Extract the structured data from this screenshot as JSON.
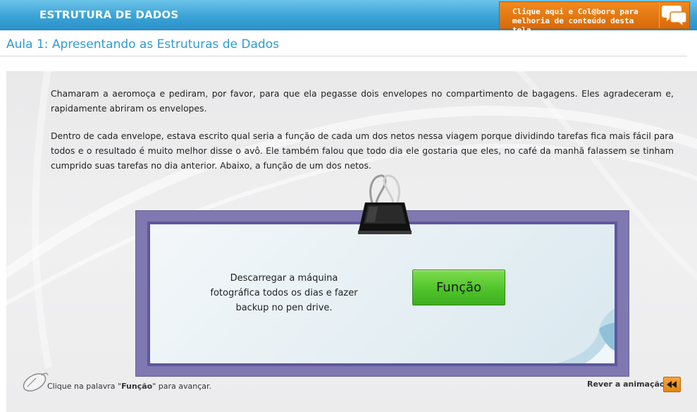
{
  "header": {
    "title": "ESTRUTURA DE DADOS",
    "collab_line1": "Clique aqui e Col@bore para",
    "collab_line2": "melhoria de conteúdo desta tela"
  },
  "lesson": {
    "title": "Aula 1: Apresentando as Estruturas de Dados"
  },
  "content": {
    "paragraph1": "Chamaram a aeromoça e pediram, por favor, para que ela pegasse dois envelopes no compartimento de bagagens. Eles agradeceram e, rapidamente abriram os envelopes.",
    "paragraph2": "Dentro de cada envelope, estava escrito qual seria a função de cada um dos netos nessa viagem porque dividindo tarefas fica mais fácil para todos e o resultado é muito melhor disse o avô. Ele também falou que todo dia ele gostaria que eles, no café da manhã falassem se tinham cumprido suas tarefas no dia anterior. Abaixo, a função de um dos netos."
  },
  "note": {
    "text": "Descarregar a máquina fotográfica todos os dias e fazer backup no pen drive.",
    "button_label": "Função"
  },
  "footer": {
    "instruction_prefix": "Clique na palavra \"",
    "instruction_keyword": "Função",
    "instruction_suffix": "\" para avançar.",
    "replay_label": "Rever a animação"
  },
  "colors": {
    "header_blue": "#3aa3d6",
    "collab_orange": "#e07a14",
    "title_blue": "#2f9ad1",
    "note_frame": "#6a62a8",
    "button_green": "#4fc42a"
  },
  "icons": {
    "collab": "chat-bubbles-icon",
    "clip": "binder-clip-icon",
    "mouse": "mouse-icon",
    "replay": "rewind-icon"
  }
}
